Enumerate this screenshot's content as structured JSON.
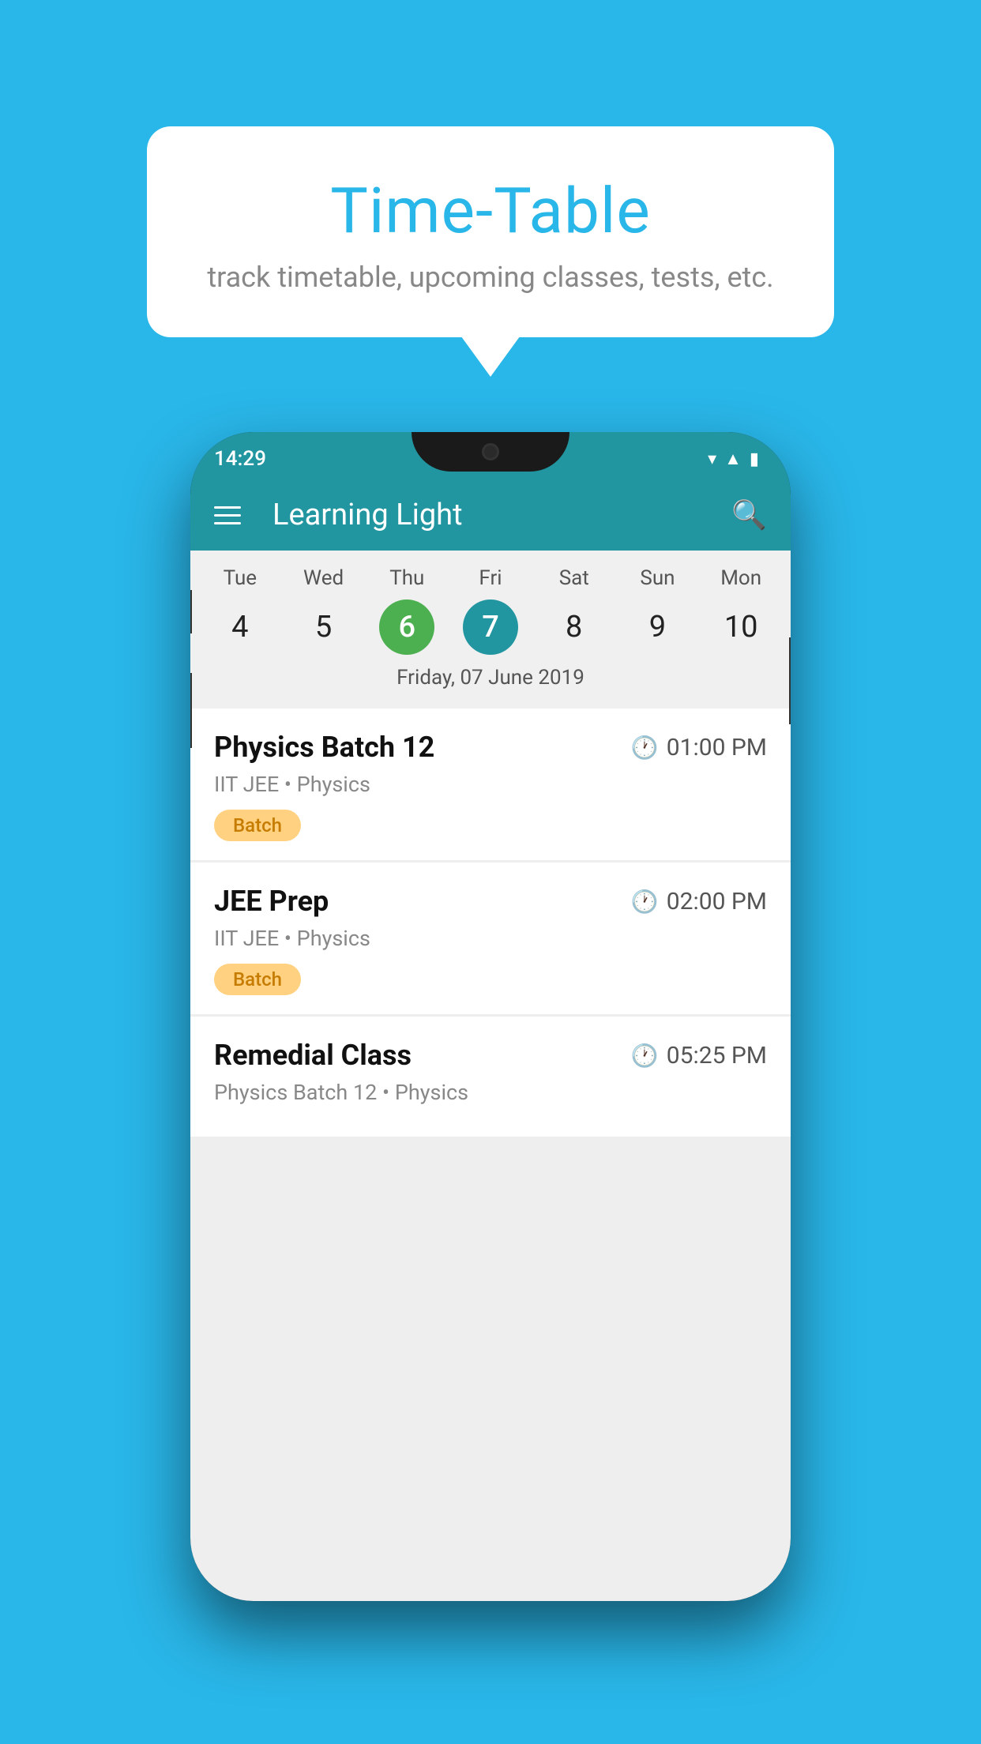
{
  "background_color": "#29b6e8",
  "speech_bubble": {
    "title": "Time-Table",
    "subtitle": "track timetable, upcoming classes, tests, etc."
  },
  "phone": {
    "status_bar": {
      "time": "14:29"
    },
    "app_bar": {
      "title": "Learning Light"
    },
    "calendar": {
      "days": [
        {
          "name": "Tue",
          "num": "4",
          "state": "normal"
        },
        {
          "name": "Wed",
          "num": "5",
          "state": "normal"
        },
        {
          "name": "Thu",
          "num": "6",
          "state": "today"
        },
        {
          "name": "Fri",
          "num": "7",
          "state": "selected"
        },
        {
          "name": "Sat",
          "num": "8",
          "state": "normal"
        },
        {
          "name": "Sun",
          "num": "9",
          "state": "normal"
        },
        {
          "name": "Mon",
          "num": "10",
          "state": "normal"
        }
      ],
      "selected_date_label": "Friday, 07 June 2019"
    },
    "classes": [
      {
        "title": "Physics Batch 12",
        "time": "01:00 PM",
        "subtitle": "IIT JEE • Physics",
        "badge": "Batch"
      },
      {
        "title": "JEE Prep",
        "time": "02:00 PM",
        "subtitle": "IIT JEE • Physics",
        "badge": "Batch"
      },
      {
        "title": "Remedial Class",
        "time": "05:25 PM",
        "subtitle": "Physics Batch 12 • Physics",
        "badge": null
      }
    ]
  }
}
